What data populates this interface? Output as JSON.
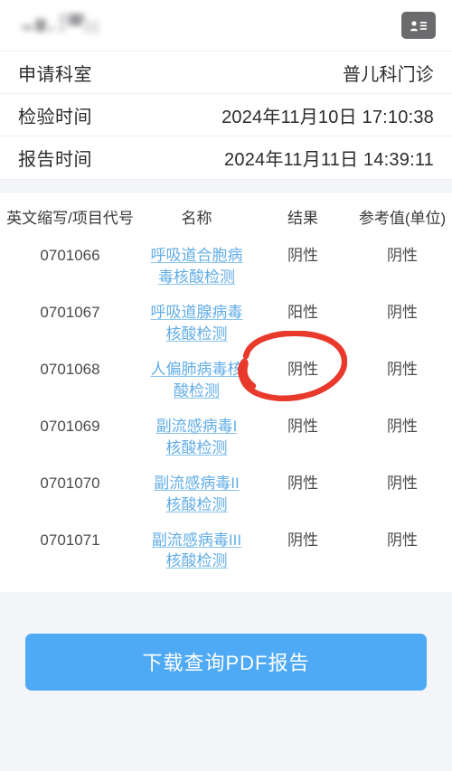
{
  "topbar": {
    "patient_name_redacted": "",
    "idcard_icon": "id-card-icon"
  },
  "info": {
    "rows": [
      {
        "label": "申请科室",
        "value": "普儿科门诊"
      },
      {
        "label": "检验时间",
        "value": "2024年11月10日 17:10:38"
      },
      {
        "label": "报告时间",
        "value": "2024年11月11日 14:39:11"
      }
    ]
  },
  "table": {
    "headers": [
      "英文缩写/项目代号",
      "名称",
      "结果",
      "参考值(单位)"
    ],
    "rows": [
      {
        "code": "0701066",
        "name": "呼吸道合胞病毒核酸检测",
        "result": "阴性",
        "ref": "阴性"
      },
      {
        "code": "0701067",
        "name": "呼吸道腺病毒核酸检测",
        "result": "阳性",
        "ref": "阴性"
      },
      {
        "code": "0701068",
        "name": "人偏肺病毒核酸检测",
        "result": "阴性",
        "ref": "阴性"
      },
      {
        "code": "0701069",
        "name": "副流感病毒I核酸检测",
        "result": "阴性",
        "ref": "阴性"
      },
      {
        "code": "0701070",
        "name": "副流感病毒II核酸检测",
        "result": "阴性",
        "ref": "阴性"
      },
      {
        "code": "0701071",
        "name": "副流感病毒III核酸检测",
        "result": "阴性",
        "ref": "阴性"
      }
    ]
  },
  "annotation": {
    "shape": "hand-drawn-ellipse",
    "target_text": "阳性",
    "color": "#e8392b"
  },
  "bottom": {
    "download_label": "下载查询PDF报告",
    "button_color": "#4faaf6"
  }
}
